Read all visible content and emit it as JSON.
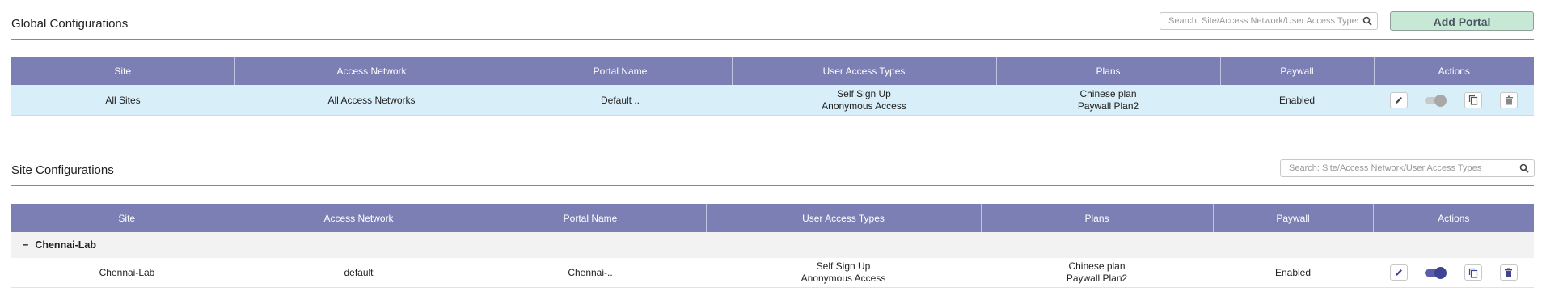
{
  "global": {
    "title": "Global Configurations",
    "search_placeholder": "Search: Site/Access Network/User Access Types",
    "add_portal_label": "Add Portal",
    "columns": [
      "Site",
      "Access Network",
      "Portal Name",
      "User Access Types",
      "Plans",
      "Paywall",
      "Actions"
    ],
    "rows": [
      {
        "site": "All Sites",
        "access_network": "All Access Networks",
        "portal_name": "Default ..",
        "user_access_types": [
          "Self Sign Up",
          "Anonymous Access"
        ],
        "plans": [
          "Chinese plan",
          "Paywall Plan2"
        ],
        "paywall": "Enabled",
        "toggle_state": "off"
      }
    ]
  },
  "site": {
    "title": "Site Configurations",
    "search_placeholder": "Search: Site/Access Network/User Access Types",
    "columns": [
      "Site",
      "Access Network",
      "Portal Name",
      "User Access Types",
      "Plans",
      "Paywall",
      "Actions"
    ],
    "groups": [
      {
        "collapse_symbol": "−",
        "name": "Chennai-Lab",
        "rows": [
          {
            "site": "Chennai-Lab",
            "access_network": "default",
            "portal_name": "Chennai-..",
            "user_access_types": [
              "Self Sign Up",
              "Anonymous Access"
            ],
            "plans": [
              "Chinese plan",
              "Paywall Plan2"
            ],
            "paywall": "Enabled",
            "toggle_state": "on"
          }
        ]
      }
    ]
  },
  "icons": {
    "search": "search-icon",
    "edit": "pencil-icon",
    "copy": "copy-icon",
    "delete": "trash-icon"
  },
  "colors": {
    "header_bg": "#7b7fb3",
    "selected_row_bg": "#d8eef8",
    "divider": "#5c9aa6",
    "add_button_bg": "#c8e8d6",
    "toggle_on": "#3f4391"
  }
}
